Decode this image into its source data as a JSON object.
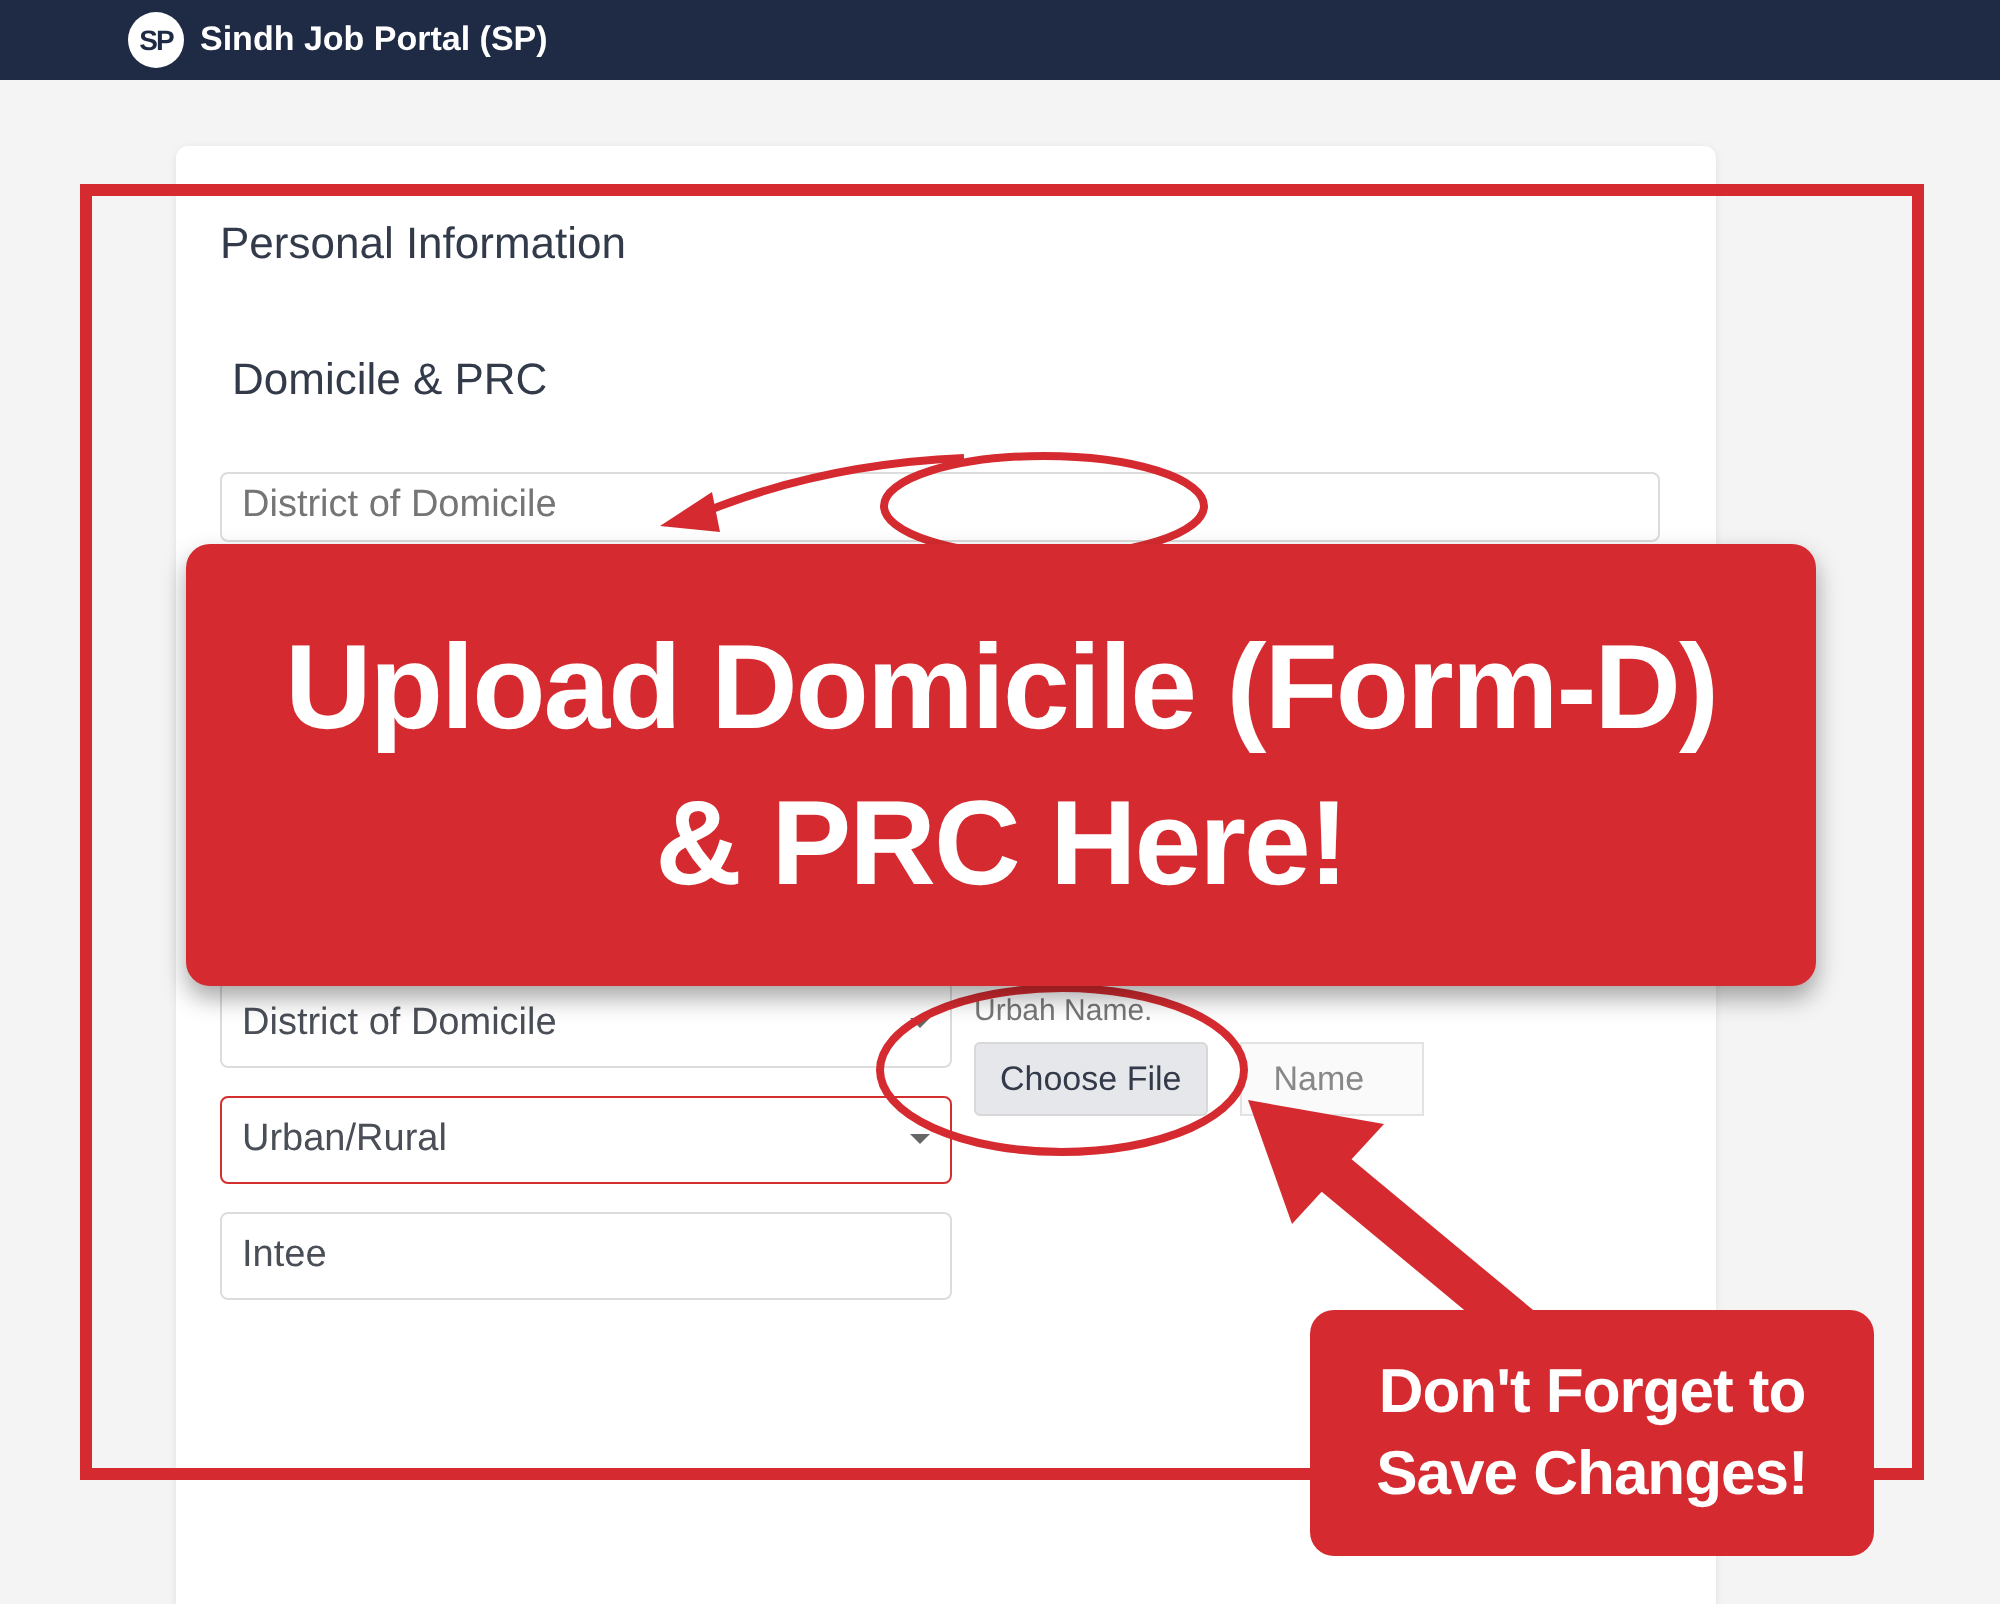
{
  "header": {
    "logo_text": "SP",
    "title": "Sindh Job Portal (SP)"
  },
  "form": {
    "title": "Personal Information",
    "section": "Domicile & PRC",
    "top_field": {
      "placeholder": "District of Domicile"
    },
    "fields": [
      {
        "kind": "select",
        "value": "District of Domicile",
        "invalid": false
      },
      {
        "kind": "select",
        "value": "Urban/Rural",
        "invalid": true
      },
      {
        "kind": "input",
        "value": "Intee",
        "invalid": false
      }
    ],
    "upload": {
      "label": "Urbah Name.",
      "button": "Choose File",
      "placeholder": "Name"
    }
  },
  "annotations": {
    "banner_lines": [
      "Upload Domicile (Form-D)",
      "& PRC Here!"
    ],
    "note_lines": [
      "Don't Forget to",
      "Save Changes!"
    ]
  }
}
